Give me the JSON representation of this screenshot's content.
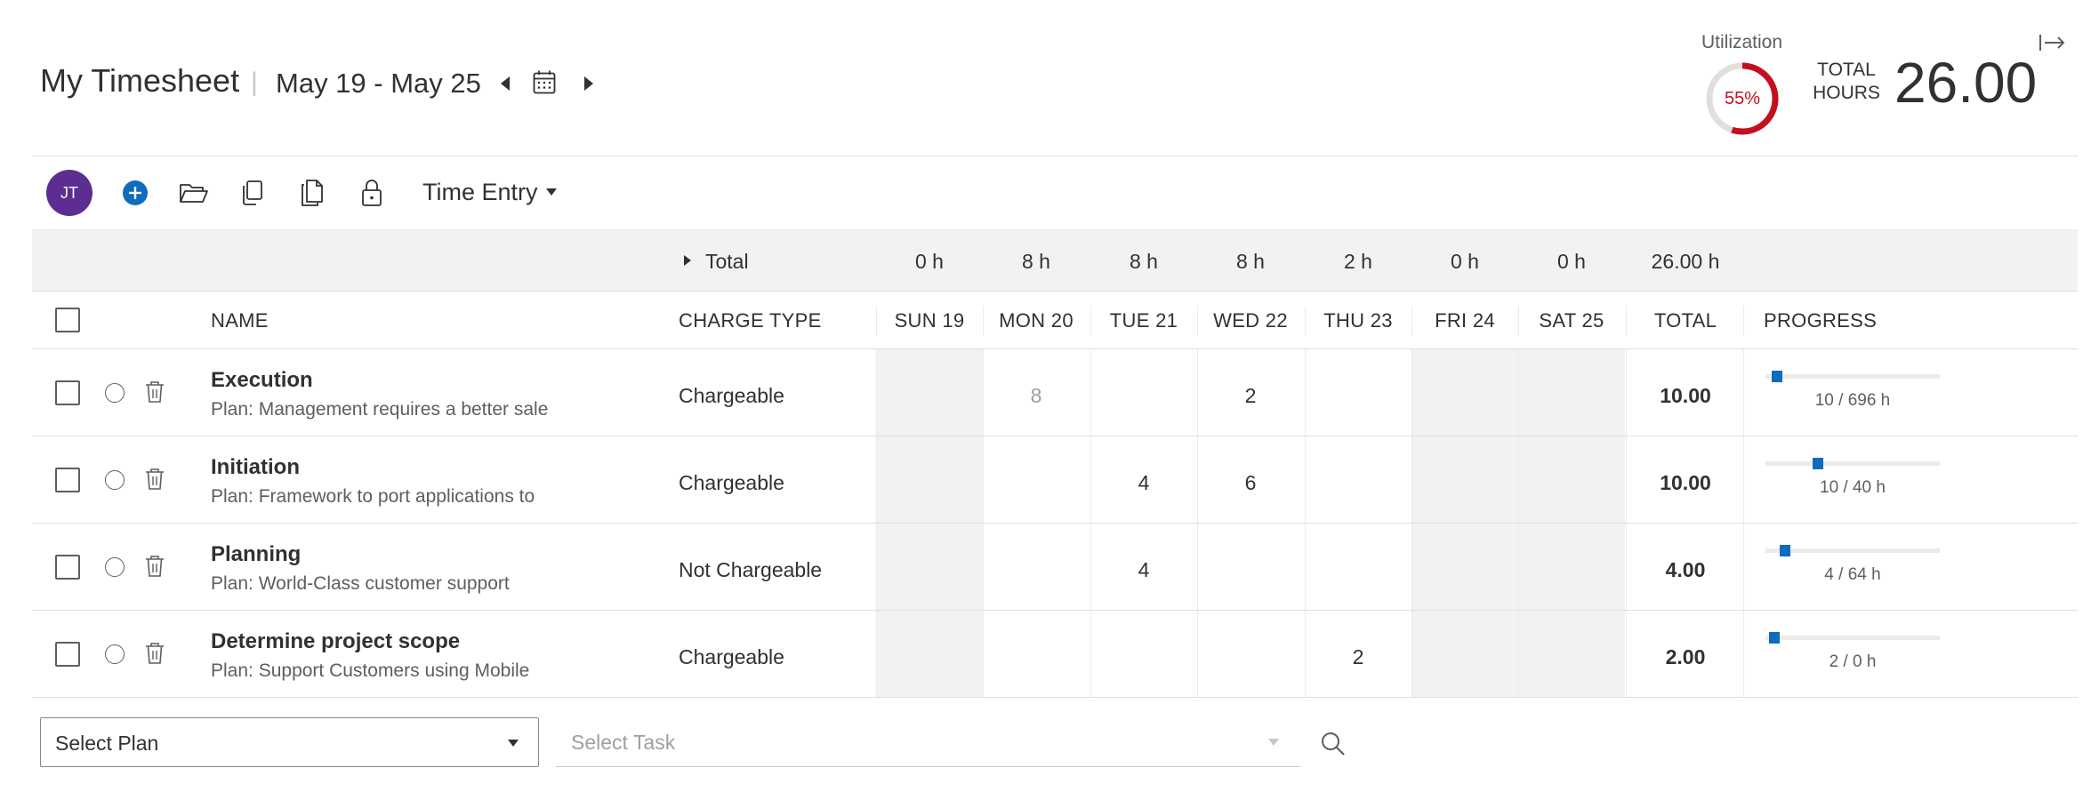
{
  "header": {
    "title": "My Timesheet",
    "separator": "|",
    "date_range": "May 19 - May 25",
    "icons": {
      "prev": "caret-left-icon",
      "calendar": "calendar-icon",
      "next": "caret-right-icon",
      "exit": "exit-panel-icon"
    }
  },
  "utilization": {
    "label": "Utilization",
    "percent_text": "55%",
    "percent": 55,
    "ring_color": "#c50f1f",
    "track_color": "#e1dfdd"
  },
  "total_hours": {
    "label_line1": "TOTAL",
    "label_line2": "HOURS",
    "value": "26.00"
  },
  "toolbar": {
    "avatar_initials": "JT",
    "avatar_color": "#5c2e91",
    "accent_color": "#0f6cbd",
    "view_label": "Time Entry",
    "icons": [
      "add-icon",
      "open-folder-icon",
      "copy-icon",
      "paste-icon",
      "lock-icon",
      "chevron-down-icon"
    ]
  },
  "totals_row": {
    "label": "Total",
    "days": [
      "0 h",
      "8 h",
      "8 h",
      "8 h",
      "2 h",
      "0 h",
      "0 h"
    ],
    "grand_total": "26.00 h"
  },
  "columns": {
    "name": "NAME",
    "charge_type": "CHARGE TYPE",
    "days": [
      "SUN 19",
      "MON 20",
      "TUE 21",
      "WED 22",
      "THU 23",
      "FRI 24",
      "SAT 25"
    ],
    "total": "TOTAL",
    "progress": "PROGRESS"
  },
  "rows": [
    {
      "name": "Execution",
      "plan": "Plan: Management requires a better sale",
      "charge_type": "Chargeable",
      "days": [
        "",
        "8",
        "",
        "2",
        "",
        "",
        ""
      ],
      "total": "10.00",
      "progress_text": "10 / 696 h",
      "progress_fraction": 0.014
    },
    {
      "name": "Initiation",
      "plan": "Plan: Framework to port applications to",
      "charge_type": "Chargeable",
      "days": [
        "",
        "",
        "4",
        "6",
        "",
        "",
        ""
      ],
      "total": "10.00",
      "progress_text": "10 / 40 h",
      "progress_fraction": 0.25
    },
    {
      "name": "Planning",
      "plan": "Plan: World-Class customer support",
      "charge_type": "Not Chargeable",
      "days": [
        "",
        "",
        "4",
        "",
        "",
        "",
        ""
      ],
      "total": "4.00",
      "progress_text": "4 / 64 h",
      "progress_fraction": 0.0625
    },
    {
      "name": "Determine project scope",
      "plan": "Plan: Support Customers using Mobile",
      "charge_type": "Chargeable",
      "days": [
        "",
        "",
        "",
        "",
        "2",
        "",
        ""
      ],
      "total": "2.00",
      "progress_text": "2 / 0 h",
      "progress_fraction": 0
    }
  ],
  "footer": {
    "plan_select": "Select Plan",
    "task_select_placeholder": "Select Task"
  }
}
